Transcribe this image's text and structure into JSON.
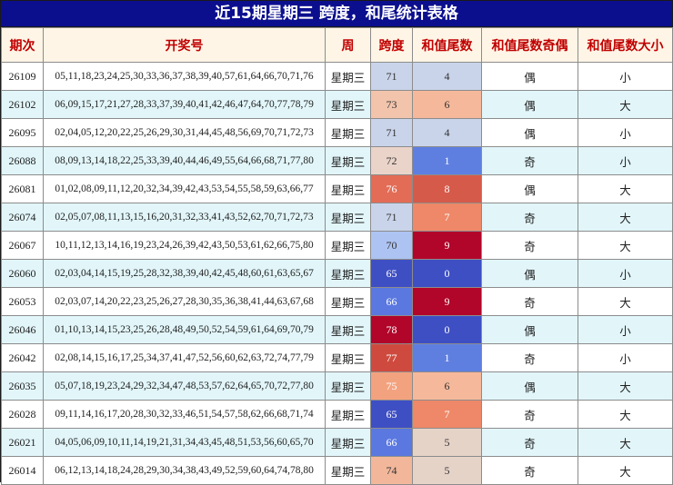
{
  "title": "近15期星期三 跨度，和尾统计表格",
  "headers": [
    "期次",
    "开奖号",
    "周",
    "跨度",
    "和值尾数",
    "和值尾数奇偶",
    "和值尾数大小"
  ],
  "rows": [
    {
      "period": "26109",
      "numbers": "05,11,18,23,24,25,30,33,36,37,38,39,40,57,61,64,66,70,71,76",
      "week": "星期三",
      "span": "71",
      "tail": "4",
      "odd_even": "偶",
      "size": "小",
      "span_color": "#c9d4ea",
      "tail_color": "#c9d4ea"
    },
    {
      "period": "26102",
      "numbers": "06,09,15,17,21,27,28,33,37,39,40,41,42,46,47,64,70,77,78,79",
      "week": "星期三",
      "span": "73",
      "tail": "6",
      "odd_even": "偶",
      "size": "大",
      "span_color": "#f2c4ac",
      "tail_color": "#f5b89a"
    },
    {
      "period": "26095",
      "numbers": "02,04,05,12,20,22,25,26,29,30,31,44,45,48,56,69,70,71,72,73",
      "week": "星期三",
      "span": "71",
      "tail": "4",
      "odd_even": "偶",
      "size": "小",
      "span_color": "#c9d4ea",
      "tail_color": "#c9d4ea"
    },
    {
      "period": "26088",
      "numbers": "08,09,13,14,18,22,25,33,39,40,44,46,49,55,64,66,68,71,77,80",
      "week": "星期三",
      "span": "72",
      "tail": "1",
      "odd_even": "奇",
      "size": "小",
      "span_color": "#ead3c9",
      "tail_color": "#5f7fe0"
    },
    {
      "period": "26081",
      "numbers": "01,02,08,09,11,12,20,32,34,39,42,43,53,54,55,58,59,63,66,77",
      "week": "星期三",
      "span": "76",
      "tail": "8",
      "odd_even": "偶",
      "size": "大",
      "span_color": "#e36c57",
      "tail_color": "#d65a4a"
    },
    {
      "period": "26074",
      "numbers": "02,05,07,08,11,13,15,16,20,31,32,33,41,43,52,62,70,71,72,73",
      "week": "星期三",
      "span": "71",
      "tail": "7",
      "odd_even": "奇",
      "size": "大",
      "span_color": "#c9d4ea",
      "tail_color": "#ee8868"
    },
    {
      "period": "26067",
      "numbers": "10,11,12,13,14,16,19,23,24,26,39,42,43,50,53,61,62,66,75,80",
      "week": "星期三",
      "span": "70",
      "tail": "9",
      "odd_even": "奇",
      "size": "大",
      "span_color": "#adc3f2",
      "tail_color": "#b1052a"
    },
    {
      "period": "26060",
      "numbers": "02,03,04,14,15,19,25,28,32,38,39,40,42,45,48,60,61,63,65,67",
      "week": "星期三",
      "span": "65",
      "tail": "0",
      "odd_even": "偶",
      "size": "小",
      "span_color": "#3e4fc4",
      "tail_color": "#3e4fc4"
    },
    {
      "period": "26053",
      "numbers": "02,03,07,14,20,22,23,25,26,27,28,30,35,36,38,41,44,63,67,68",
      "week": "星期三",
      "span": "66",
      "tail": "9",
      "odd_even": "奇",
      "size": "大",
      "span_color": "#5a78e0",
      "tail_color": "#b1052a"
    },
    {
      "period": "26046",
      "numbers": "01,10,13,14,15,23,25,26,28,48,49,50,52,54,59,61,64,69,70,79",
      "week": "星期三",
      "span": "78",
      "tail": "0",
      "odd_even": "偶",
      "size": "小",
      "span_color": "#b1052a",
      "tail_color": "#3e4fc4"
    },
    {
      "period": "26042",
      "numbers": "02,08,14,15,16,17,25,34,37,41,47,52,56,60,62,63,72,74,77,79",
      "week": "星期三",
      "span": "77",
      "tail": "1",
      "odd_even": "奇",
      "size": "小",
      "span_color": "#cf4a3e",
      "tail_color": "#5f7fe0"
    },
    {
      "period": "26035",
      "numbers": "05,07,18,19,23,24,29,32,34,47,48,53,57,62,64,65,70,72,77,80",
      "week": "星期三",
      "span": "75",
      "tail": "6",
      "odd_even": "偶",
      "size": "大",
      "span_color": "#f3a27f",
      "tail_color": "#f5b89a"
    },
    {
      "period": "26028",
      "numbers": "09,11,14,16,17,20,28,30,32,33,46,51,54,57,58,62,66,68,71,74",
      "week": "星期三",
      "span": "65",
      "tail": "7",
      "odd_even": "奇",
      "size": "大",
      "span_color": "#3e4fc4",
      "tail_color": "#ee8868"
    },
    {
      "period": "26021",
      "numbers": "04,05,06,09,10,11,14,19,21,31,34,43,45,48,51,53,56,60,65,70",
      "week": "星期三",
      "span": "66",
      "tail": "5",
      "odd_even": "奇",
      "size": "大",
      "span_color": "#5a78e0",
      "tail_color": "#e6d3c8"
    },
    {
      "period": "26014",
      "numbers": "06,12,13,14,18,24,28,29,30,34,38,43,49,52,59,60,64,74,78,80",
      "week": "星期三",
      "span": "74",
      "tail": "5",
      "odd_even": "奇",
      "size": "大",
      "span_color": "#f2b79b",
      "tail_color": "#e6d3c8"
    }
  ]
}
